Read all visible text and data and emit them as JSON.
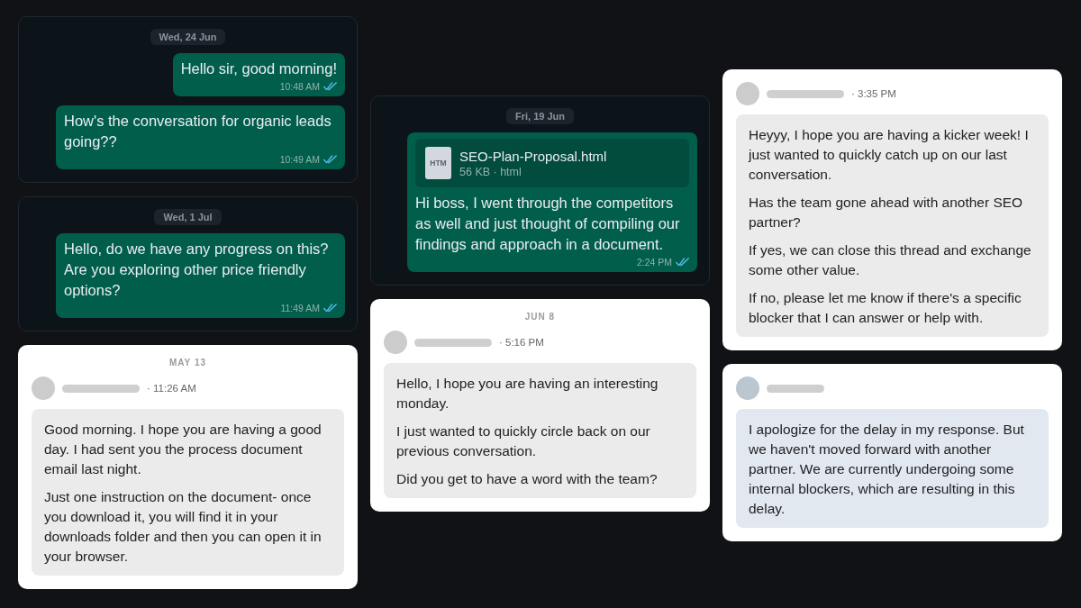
{
  "columns": [
    {
      "cards": [
        {
          "kind": "chat",
          "date": "Wed, 24 Jun",
          "messages": [
            {
              "kind": "text",
              "text": "Hello sir, good morning!",
              "time": "10:48 AM",
              "read": true
            },
            {
              "kind": "text",
              "text": "How's the conversation for organic leads going??",
              "time": "10:49 AM",
              "read": true
            }
          ]
        },
        {
          "kind": "chat",
          "date": "Wed, 1 Jul",
          "messages": [
            {
              "kind": "text",
              "text": "Hello, do we have any progress on this? Are you exploring other price friendly options?",
              "time": "11:49 AM",
              "read": true
            }
          ]
        },
        {
          "kind": "email",
          "date": "MAY 13",
          "avatar": {
            "color": "#cccccc"
          },
          "color": "#ebebeb",
          "time": "· 11:26 AM",
          "paragraphs": [
            "Good morning. I hope you are having a good day. I had sent you the process document email last night.",
            "Just one instruction on the document- once you download it, you will find it in your downloads folder and then you can open it in your browser."
          ]
        }
      ]
    },
    {
      "cards": [
        {
          "kind": "chat",
          "date": "Fri, 19 Jun",
          "messages": [
            {
              "kind": "file",
              "file": {
                "type_label": "HTM",
                "name": "SEO-Plan-Proposal.html",
                "meta": "56 KB · html"
              },
              "text": "Hi boss, I went through the competitors as well and just thought of compiling our findings and approach in a document.",
              "time": "2:24 PM",
              "read": true
            }
          ]
        },
        {
          "kind": "email",
          "date": "JUN 8",
          "avatar": {
            "color": "#cccccc"
          },
          "color": "#ebebeb",
          "time": "· 5:16 PM",
          "paragraphs": [
            "Hello, I hope you are having an interesting monday.",
            "I just wanted to quickly circle back on our previous conversation.",
            "Did you get to have a word with the team?"
          ]
        }
      ]
    },
    {
      "cards": [
        {
          "kind": "email",
          "avatar": {
            "color": "#cccccc"
          },
          "color": "#ebebeb",
          "time": "· 3:35 PM",
          "paragraphs": [
            "Heyyy, I hope you are having a kicker week! I just wanted to quickly catch up on our last conversation.",
            "Has the team gone ahead with another SEO partner?",
            "If yes, we can close this thread and exchange some other value.",
            "If no, please let me know if there's a specific blocker that I can answer or help with."
          ]
        },
        {
          "kind": "email",
          "avatar": {
            "color": "#bcc6cf"
          },
          "color": "#e2e8f0",
          "paragraphs": [
            "I apologize for the delay in my response. But we haven't moved forward with another partner. We are currently undergoing some internal blockers, which are resulting in this delay."
          ]
        }
      ]
    }
  ]
}
